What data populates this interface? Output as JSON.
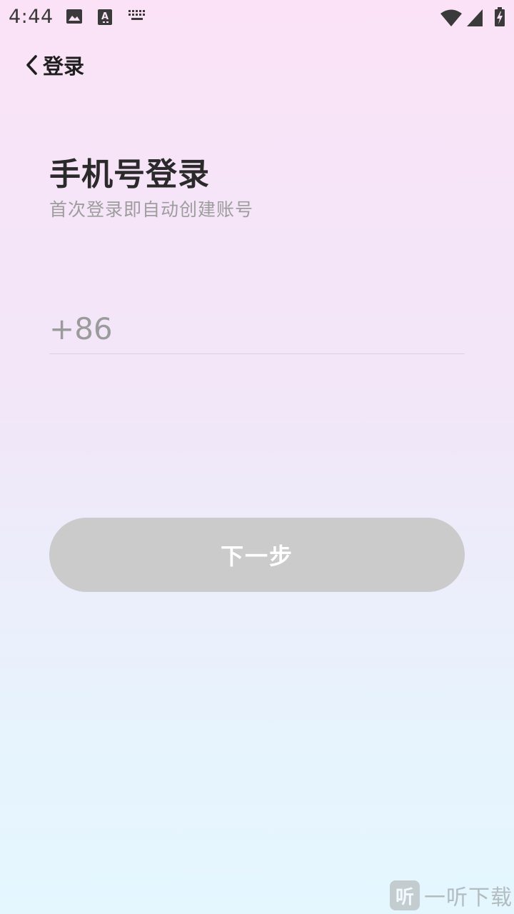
{
  "status_bar": {
    "time": "4:44",
    "icons": [
      "image-icon",
      "text-a-icon",
      "keyboard-icon",
      "wifi-icon",
      "signal-icon",
      "battery-charging-icon"
    ]
  },
  "nav": {
    "back_icon": "chevron-left-icon",
    "title": "登录"
  },
  "page": {
    "title": "手机号登录",
    "subtitle": "首次登录即自动创建账号"
  },
  "phone": {
    "country_code": "+86",
    "value": "",
    "placeholder": ""
  },
  "next_button": {
    "label": "下一步",
    "background": "#cbcbcb"
  },
  "watermark": {
    "badge": "听",
    "text": "一听下载"
  }
}
